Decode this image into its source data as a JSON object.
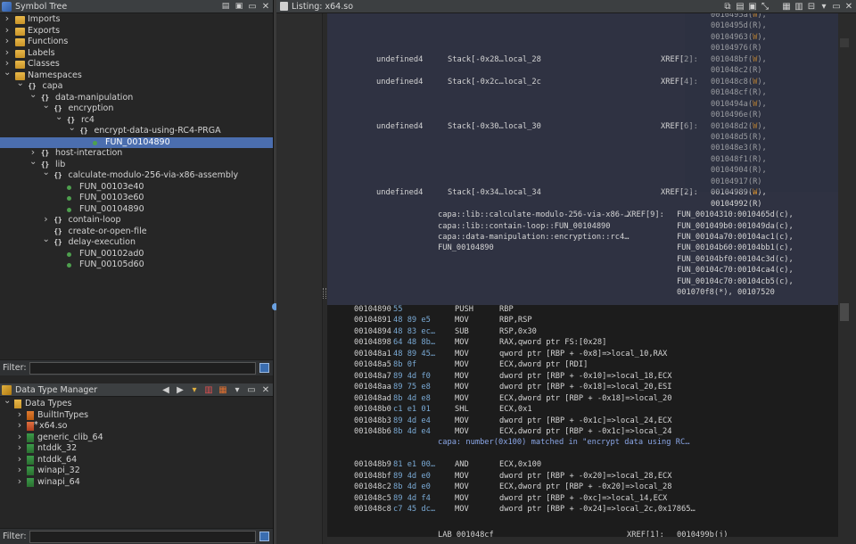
{
  "symbol_tree": {
    "title": "Symbol Tree",
    "filter_label": "Filter:",
    "rows": [
      {
        "label": "Imports",
        "level": 0,
        "kind": "folder",
        "twisty": ">"
      },
      {
        "label": "Exports",
        "level": 0,
        "kind": "folder",
        "twisty": ">"
      },
      {
        "label": "Functions",
        "level": 0,
        "kind": "folder",
        "twisty": ">"
      },
      {
        "label": "Labels",
        "level": 0,
        "kind": "folder",
        "twisty": ">"
      },
      {
        "label": "Classes",
        "level": 0,
        "kind": "folder",
        "twisty": ">"
      },
      {
        "label": "Namespaces",
        "level": 0,
        "kind": "folder",
        "twisty": "v"
      },
      {
        "label": "capa",
        "level": 1,
        "kind": "ns",
        "twisty": "v"
      },
      {
        "label": "data-manipulation",
        "level": 2,
        "kind": "ns",
        "twisty": "v"
      },
      {
        "label": "encryption",
        "level": 3,
        "kind": "ns",
        "twisty": "v"
      },
      {
        "label": "rc4",
        "level": 4,
        "kind": "ns",
        "twisty": "v"
      },
      {
        "label": "encrypt-data-using-RC4-PRGA",
        "level": 5,
        "kind": "ns",
        "twisty": "v"
      },
      {
        "label": "FUN_00104890",
        "level": 6,
        "kind": "fn",
        "twisty": "",
        "selected": true
      },
      {
        "label": "host-interaction",
        "level": 2,
        "kind": "ns",
        "twisty": ">"
      },
      {
        "label": "lib",
        "level": 2,
        "kind": "ns",
        "twisty": "v"
      },
      {
        "label": "calculate-modulo-256-via-x86-assembly",
        "level": 3,
        "kind": "ns",
        "twisty": "v"
      },
      {
        "label": "FUN_00103e40",
        "level": 4,
        "kind": "fn",
        "twisty": ""
      },
      {
        "label": "FUN_00103e60",
        "level": 4,
        "kind": "fn",
        "twisty": ""
      },
      {
        "label": "FUN_00104890",
        "level": 4,
        "kind": "fn",
        "twisty": ""
      },
      {
        "label": "contain-loop",
        "level": 3,
        "kind": "ns",
        "twisty": ">"
      },
      {
        "label": "create-or-open-file",
        "level": 3,
        "kind": "ns",
        "twisty": ""
      },
      {
        "label": "delay-execution",
        "level": 3,
        "kind": "ns",
        "twisty": "v"
      },
      {
        "label": "FUN_00102ad0",
        "level": 4,
        "kind": "fn",
        "twisty": ""
      },
      {
        "label": "FUN_00105d60",
        "level": 4,
        "kind": "fn",
        "twisty": ""
      }
    ]
  },
  "data_type_manager": {
    "title": "Data Type Manager",
    "filter_label": "Filter:",
    "rows": [
      {
        "label": "Data Types",
        "level": 0,
        "twisty": "v",
        "kind": "dtfolder"
      },
      {
        "label": "BuiltInTypes",
        "level": 1,
        "twisty": ">",
        "kind": "arch"
      },
      {
        "label": "x64.so",
        "level": 1,
        "twisty": ">",
        "kind": "archred"
      },
      {
        "label": "generic_clib_64",
        "level": 1,
        "twisty": ">",
        "kind": "arch"
      },
      {
        "label": "ntddk_32",
        "level": 1,
        "twisty": ">",
        "kind": "arch"
      },
      {
        "label": "ntddk_64",
        "level": 1,
        "twisty": ">",
        "kind": "arch"
      },
      {
        "label": "winapi_32",
        "level": 1,
        "twisty": ">",
        "kind": "arch"
      },
      {
        "label": "winapi_64",
        "level": 1,
        "twisty": ">",
        "kind": "arch"
      }
    ]
  },
  "listing": {
    "title": "Listing:  x64.so",
    "xref_list_top": [
      "0010495a(W),",
      "0010495d(R),",
      "00104963(W),",
      "00104976(R)"
    ],
    "locals": [
      {
        "type": "undefined4",
        "storage": "Stack[-0x28…",
        "name": "local_28",
        "xref": "XREF[2]:",
        "refs": [
          "001048bf(W),",
          "001048c2(R)"
        ]
      },
      {
        "type": "undefined4",
        "storage": "Stack[-0x2c…",
        "name": "local_2c",
        "xref": "XREF[4]:",
        "refs": [
          "001048c8(W),",
          "001048cf(R),",
          "0010494a(W),",
          "0010496e(R)"
        ]
      },
      {
        "type": "undefined4",
        "storage": "Stack[-0x30…",
        "name": "local_30",
        "xref": "XREF[6]:",
        "refs": [
          "001048d2(W),",
          "001048d5(R),",
          "001048e3(R),",
          "001048f1(R),",
          "00104904(R),",
          "00104917(R)"
        ]
      },
      {
        "type": "undefined4",
        "storage": "Stack[-0x34…",
        "name": "local_34",
        "xref": "XREF[2]:",
        "refs": [
          "00104989(W),",
          "00104992(R)"
        ]
      }
    ],
    "labels": [
      "capa::lib::calculate-modulo-256-via-x86-…",
      "capa::lib::contain-loop::FUN_00104890",
      "capa::data-manipulation::encryption::rc4…",
      "FUN_00104890"
    ],
    "fn_xref": "XREF[9]:",
    "fn_refs": [
      "FUN_00104310:0010465d(c),",
      "FUN_001049b0:001049da(c),",
      "FUN_00104a70:00104ac1(c),",
      "FUN_00104b60:00104bb1(c),",
      "FUN_00104bf0:00104c3d(c),",
      "FUN_00104c70:00104ca4(c),",
      "FUN_00104c70:00104cb5(c),",
      "001070f8(*), 00107520"
    ],
    "instructions": [
      {
        "addr": "00104890",
        "bytes": "55",
        "mn": "PUSH",
        "op": "RBP"
      },
      {
        "addr": "00104891",
        "bytes": "48 89 e5",
        "mn": "MOV",
        "op": "RBP,RSP"
      },
      {
        "addr": "00104894",
        "bytes": "48 83 ec…",
        "mn": "SUB",
        "op": "RSP,0x30"
      },
      {
        "addr": "00104898",
        "bytes": "64 48 8b…",
        "mn": "MOV",
        "op": "RAX,qword ptr FS:[0x28]"
      },
      {
        "addr": "001048a1",
        "bytes": "48 89 45…",
        "mn": "MOV",
        "op": "qword ptr [RBP + -0x8]=>local_10,RAX"
      },
      {
        "addr": "001048a5",
        "bytes": "8b 0f",
        "mn": "MOV",
        "op": "ECX,dword ptr [RDI]"
      },
      {
        "addr": "001048a7",
        "bytes": "89 4d f0",
        "mn": "MOV",
        "op": "dword ptr [RBP + -0x10]=>local_18,ECX"
      },
      {
        "addr": "001048aa",
        "bytes": "89 75 e8",
        "mn": "MOV",
        "op": "dword ptr [RBP + -0x18]=>local_20,ESI"
      },
      {
        "addr": "001048ad",
        "bytes": "8b 4d e8",
        "mn": "MOV",
        "op": "ECX,dword ptr [RBP + -0x18]=>local_20"
      },
      {
        "addr": "001048b0",
        "bytes": "c1 e1 01",
        "mn": "SHL",
        "op": "ECX,0x1"
      },
      {
        "addr": "001048b3",
        "bytes": "89 4d e4",
        "mn": "MOV",
        "op": "dword ptr [RBP + -0x1c]=>local_24,ECX"
      },
      {
        "addr": "001048b6",
        "bytes": "8b 4d e4",
        "mn": "MOV",
        "op": "ECX,dword ptr [RBP + -0x1c]=>local_24"
      }
    ],
    "capa_comment": "capa: number(0x100) matched in \"encrypt data using RC…",
    "instructions2": [
      {
        "addr": "001048b9",
        "bytes": "81 e1 00…",
        "mn": "AND",
        "op": "ECX,0x100"
      },
      {
        "addr": "001048bf",
        "bytes": "89 4d e0",
        "mn": "MOV",
        "op": "dword ptr [RBP + -0x20]=>local_28,ECX"
      },
      {
        "addr": "001048c2",
        "bytes": "8b 4d e0",
        "mn": "MOV",
        "op": "ECX,dword ptr [RBP + -0x20]=>local_28"
      },
      {
        "addr": "001048c5",
        "bytes": "89 4d f4",
        "mn": "MOV",
        "op": "dword ptr [RBP + -0xc]=>local_14,ECX"
      },
      {
        "addr": "001048c8",
        "bytes": "c7 45 dc…",
        "mn": "MOV",
        "op": "dword ptr [RBP + -0x24]=>local_2c,0x17865…"
      }
    ],
    "label_bottom": "LAB_001048cf",
    "label_bottom_xref": "XREF[1]:",
    "label_bottom_ref": "0010499b(j)"
  },
  "colors": {
    "selection": "#4b6eaf",
    "header_bg": "#2f3242",
    "code_bg": "#1c1c1c",
    "write_ref": "#f0a030",
    "bytes": "#79a9d4",
    "fn_dot": "#4ea04e"
  }
}
